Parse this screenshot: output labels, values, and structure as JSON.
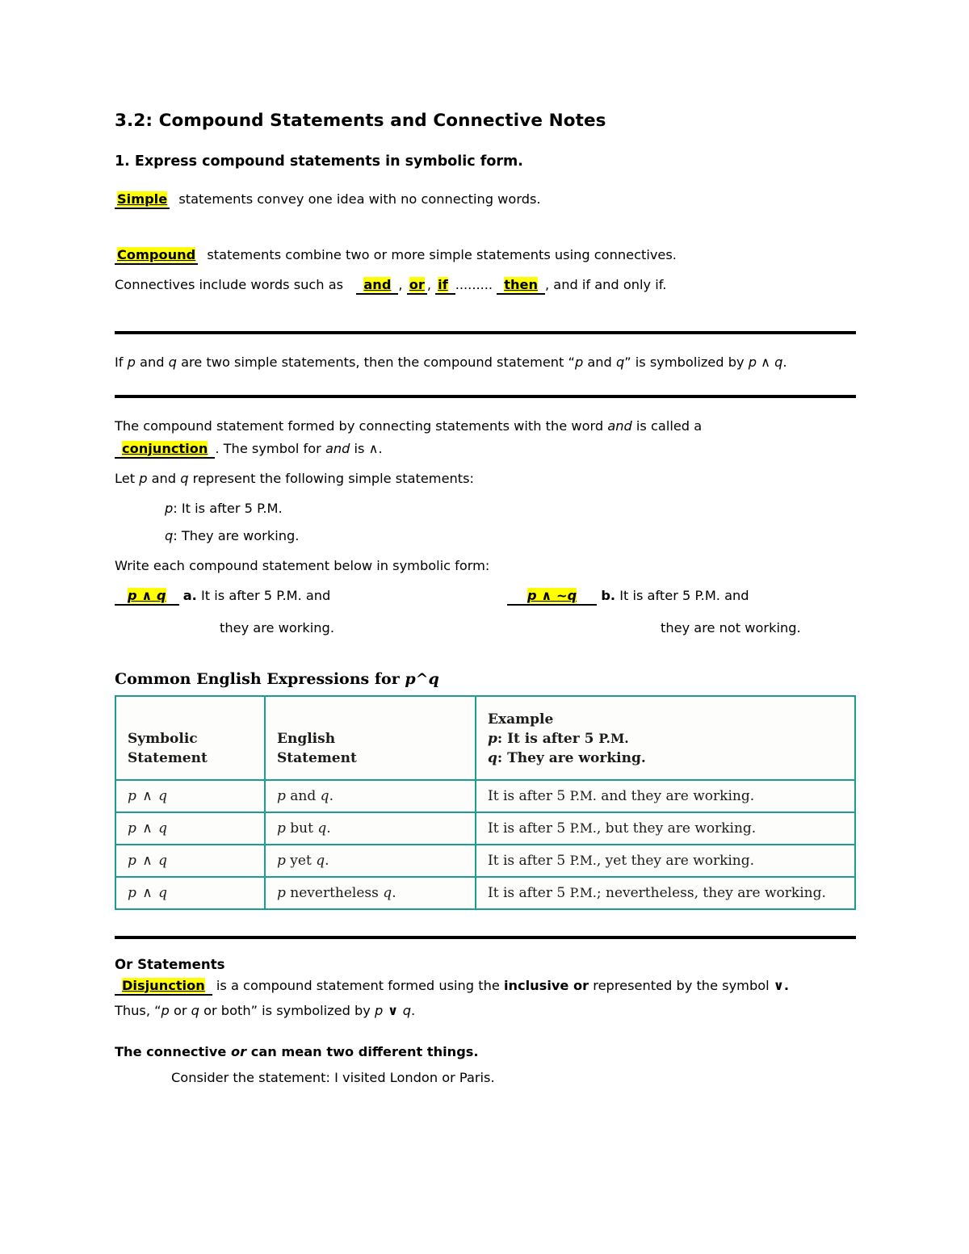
{
  "document": {
    "title": "3.2: Compound Statements and Connective Notes",
    "objective": "1. Express compound statements in symbolic form."
  },
  "simple_line": {
    "answer": "Simple",
    "rest": "statements convey one idea with no connecting words."
  },
  "compound_line": {
    "answer": "Compound",
    "rest": "statements combine two or more simple statements using connectives."
  },
  "connectives_line": {
    "lead": "Connectives include words such as",
    "a1": "and",
    "sep1": ",",
    "a2": "or",
    "sep2": ",",
    "a3": "if",
    "dots": ".........",
    "a4": "then",
    "tail": ", and if and only if."
  },
  "rule_box_1": {
    "text_1": "If ",
    "p1": "p",
    "text_2": " and ",
    "q1": "q",
    "text_3": " are two simple statements, then the compound statement “",
    "p2": "p",
    "text_4": " and ",
    "q2": "q",
    "text_5": "” is symbolized by ",
    "p3": "p",
    "wedge": " ∧ ",
    "q3": "q",
    "text_6": "."
  },
  "conjunction_def": {
    "line1_a": "The compound statement formed by connecting statements with the word ",
    "line1_and": "and",
    "line1_b": " is called a",
    "answer": "conjunction",
    "line2_a": ". The symbol for ",
    "line2_and": "and",
    "line2_b": " is ∧."
  },
  "let_line": {
    "a": "Let ",
    "p": "p",
    "b": " and ",
    "q": "q",
    "c": " represent the following simple statements:"
  },
  "statements": [
    {
      "var": "p",
      "text": ":  It is after 5 P.M."
    },
    {
      "var": "q",
      "text": ":  They are working."
    }
  ],
  "write_prompt": "Write each compound statement below in symbolic form:",
  "answers": [
    {
      "symbol": "p ∧ q",
      "letter": "a.",
      "text_line1": "It is after 5 P.M. and",
      "text_line2": "they are working."
    },
    {
      "symbol": "p ∧ ~q",
      "letter": "b.",
      "text_line1": "It is after 5 P.M. and",
      "text_line2": "they are not working."
    }
  ],
  "table": {
    "caption_text": "Common English Expressions for ",
    "caption_symbol": "p^q",
    "headers": {
      "col1_line1": "Symbolic",
      "col1_line2": "Statement",
      "col2_line1": "English",
      "col2_line2": "Statement",
      "col3_line1": "Example",
      "col3_line2_var": "p",
      "col3_line2_text": ": It is after 5 ",
      "col3_line2_sc": "P.M.",
      "col3_line3_var": "q",
      "col3_line3_text": ": They are working."
    },
    "rows": [
      {
        "symbolic": "p ∧ q",
        "english_var1": "p",
        "english_mid": " and ",
        "english_var2": "q",
        "english_end": ".",
        "example_a": "It is after 5 ",
        "example_sc": "P.M.",
        "example_b": " and they are working."
      },
      {
        "symbolic": "p ∧ q",
        "english_var1": "p",
        "english_mid": " but ",
        "english_var2": "q",
        "english_end": ".",
        "example_a": "It is after 5 ",
        "example_sc": "P.M.",
        "example_b": ", but they are working."
      },
      {
        "symbolic": "p ∧ q",
        "english_var1": "p",
        "english_mid": " yet ",
        "english_var2": "q",
        "english_end": ".",
        "example_a": "It is after 5 ",
        "example_sc": "P.M.",
        "example_b": ", yet they are working."
      },
      {
        "symbolic": "p ∧ q",
        "english_var1": "p",
        "english_mid": " nevertheless ",
        "english_var2": "q",
        "english_end": ".",
        "example_a": "It is after 5 ",
        "example_sc": "P.M.",
        "example_b": "; nevertheless, they are working."
      }
    ]
  },
  "or_section": {
    "heading": "Or Statements",
    "answer": "Disjunction",
    "line1_a": "is a compound statement formed using the ",
    "line1_bold": "inclusive or",
    "line1_b": " represented by the symbol  ",
    "line1_symbol": "∨.",
    "line2_a": "Thus, “",
    "line2_p": "p",
    "line2_or": " or ",
    "line2_q": "q",
    "line2_both": " or both” is symbolized by ",
    "line2_p2": "p",
    "line2_vee": " ∨ ",
    "line2_q2": "q",
    "line2_end": "."
  },
  "bottom": {
    "line1_a": "The connective ",
    "line1_it": "or",
    "line1_b": " can mean two different things.",
    "line2": "Consider the statement: I visited London or Paris."
  },
  "colors": {
    "highlight": "#ffff00",
    "table_border": "#1a9e8f",
    "text": "#000000"
  }
}
